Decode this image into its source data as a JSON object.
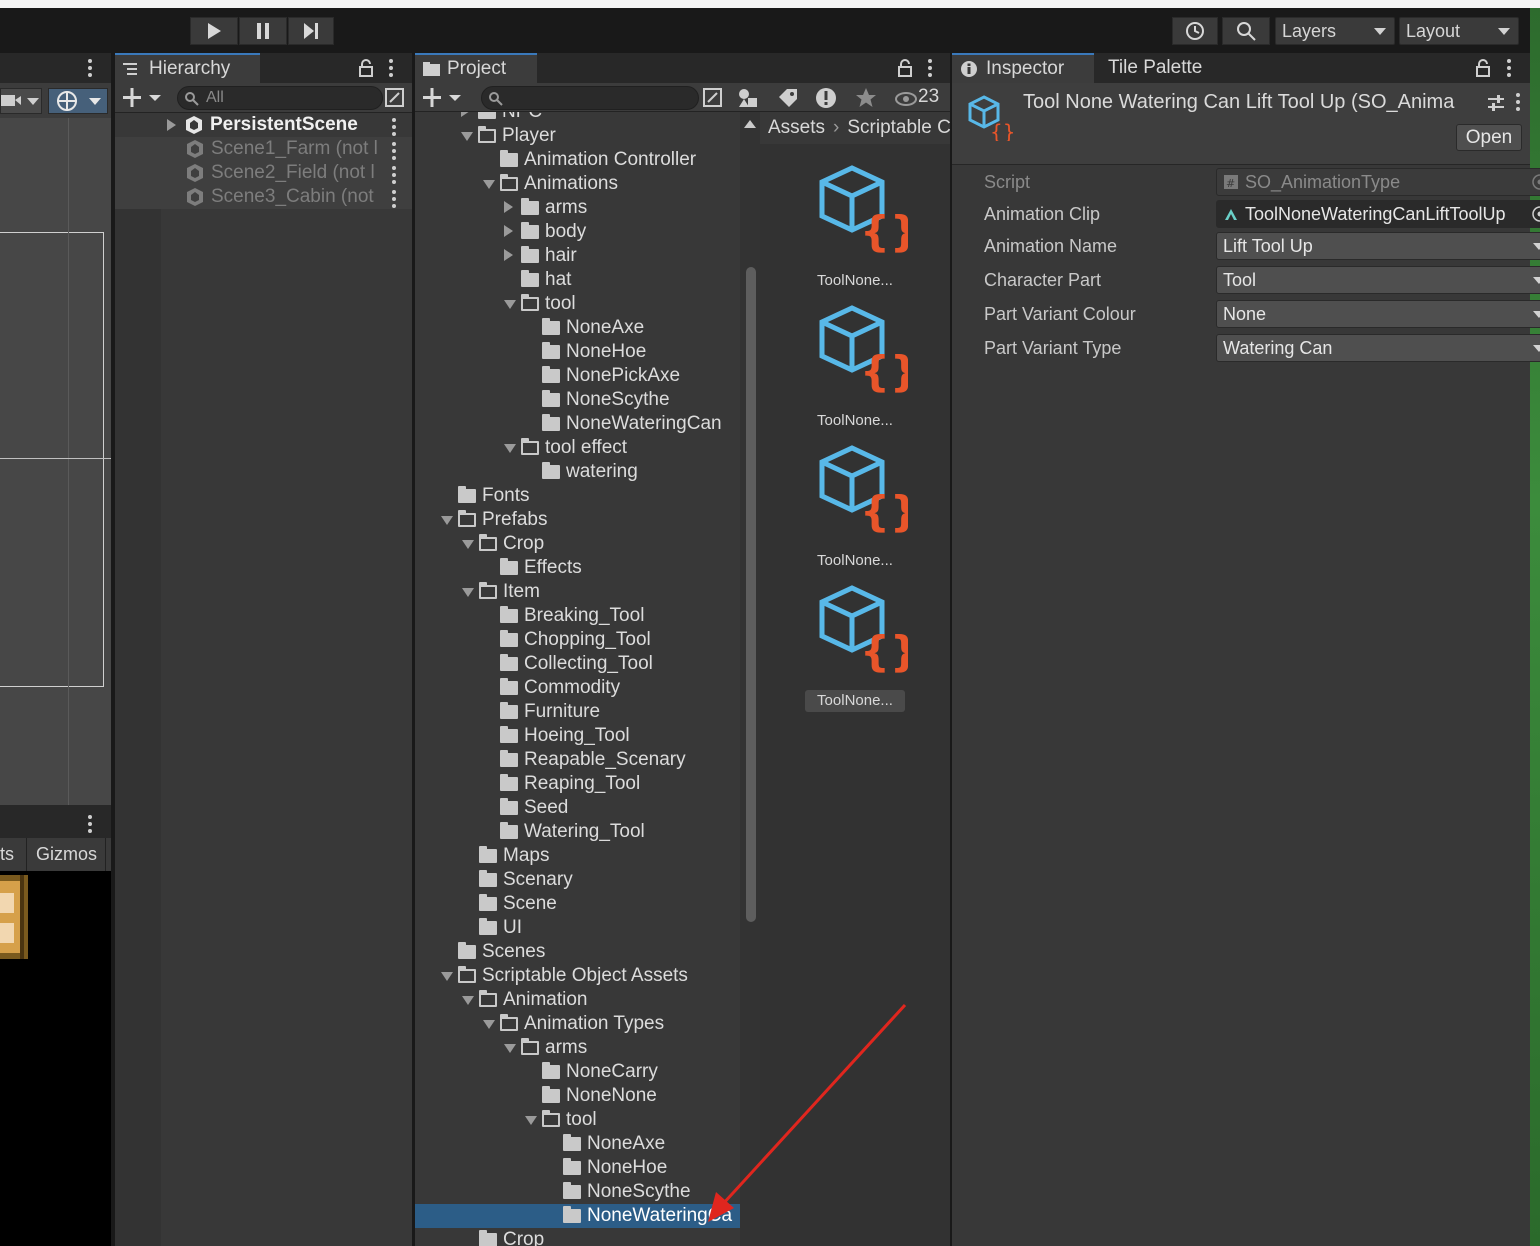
{
  "toolbar": {
    "play_icon": "play-icon",
    "pause_icon": "pause-icon",
    "step_icon": "step-icon",
    "history_icon": "history-icon",
    "search_icon": "search-icon",
    "layers_label": "Layers",
    "layout_label": "Layout"
  },
  "scene": {
    "game_tab_partial": "ts",
    "gizmos_label": "Gizmos"
  },
  "hierarchy": {
    "tab_label": "Hierarchy",
    "search_placeholder": "All",
    "rows": [
      {
        "label": "PersistentScene"
      },
      {
        "label": "Scene1_Farm (not l"
      },
      {
        "label": "Scene2_Field (not l"
      },
      {
        "label": "Scene3_Cabin (not"
      }
    ]
  },
  "project": {
    "tab_label": "Project",
    "hidden_count": "23",
    "breadcrumb_root": "Assets",
    "breadcrumb_child": "Scriptable C",
    "tree": [
      {
        "label": "NPC"
      },
      {
        "label": "Player"
      },
      {
        "label": "Animation Controller"
      },
      {
        "label": "Animations"
      },
      {
        "label": "arms"
      },
      {
        "label": "body"
      },
      {
        "label": "hair"
      },
      {
        "label": "hat"
      },
      {
        "label": "tool"
      },
      {
        "label": "NoneAxe"
      },
      {
        "label": "NoneHoe"
      },
      {
        "label": "NonePickAxe"
      },
      {
        "label": "NoneScythe"
      },
      {
        "label": "NoneWateringCan"
      },
      {
        "label": "tool effect"
      },
      {
        "label": "watering"
      },
      {
        "label": "Fonts"
      },
      {
        "label": "Prefabs"
      },
      {
        "label": "Crop"
      },
      {
        "label": "Effects"
      },
      {
        "label": "Item"
      },
      {
        "label": "Breaking_Tool"
      },
      {
        "label": "Chopping_Tool"
      },
      {
        "label": "Collecting_Tool"
      },
      {
        "label": "Commodity"
      },
      {
        "label": "Furniture"
      },
      {
        "label": "Hoeing_Tool"
      },
      {
        "label": "Reapable_Scenary"
      },
      {
        "label": "Reaping_Tool"
      },
      {
        "label": "Seed"
      },
      {
        "label": "Watering_Tool"
      },
      {
        "label": "Maps"
      },
      {
        "label": "Scenary"
      },
      {
        "label": "Scene"
      },
      {
        "label": "UI"
      },
      {
        "label": "Scenes"
      },
      {
        "label": "Scriptable Object Assets"
      },
      {
        "label": "Animation"
      },
      {
        "label": "Animation Types"
      },
      {
        "label": "arms"
      },
      {
        "label": "NoneCarry"
      },
      {
        "label": "NoneNone"
      },
      {
        "label": "tool"
      },
      {
        "label": "NoneAxe"
      },
      {
        "label": "NoneHoe"
      },
      {
        "label": "NoneScythe"
      },
      {
        "label": "NoneWateringCa"
      },
      {
        "label": "Crop"
      }
    ],
    "assets": [
      {
        "label": "ToolNone..."
      },
      {
        "label": "ToolNone..."
      },
      {
        "label": "ToolNone..."
      },
      {
        "label": "ToolNone..."
      }
    ]
  },
  "inspector": {
    "tab_label": "Inspector",
    "tab2_label": "Tile Palette",
    "title": "Tool None Watering Can Lift Tool Up (SO_Anima",
    "open_label": "Open",
    "properties": [
      {
        "label": "Script",
        "value": "SO_AnimationType"
      },
      {
        "label": "Animation Clip",
        "value": "ToolNoneWateringCanLiftToolUp"
      },
      {
        "label": "Animation Name",
        "value": "Lift Tool Up"
      },
      {
        "label": "Character Part",
        "value": "Tool"
      },
      {
        "label": "Part Variant Colour",
        "value": "None"
      },
      {
        "label": "Part Variant Type",
        "value": "Watering Can"
      }
    ]
  },
  "colors": {
    "selection": "#2c5d87",
    "tab_accent": "#3a79bb",
    "annotation_arrow": "#e0261e",
    "asset_cube": "#58b8e8",
    "asset_braces": "#e8552a"
  }
}
